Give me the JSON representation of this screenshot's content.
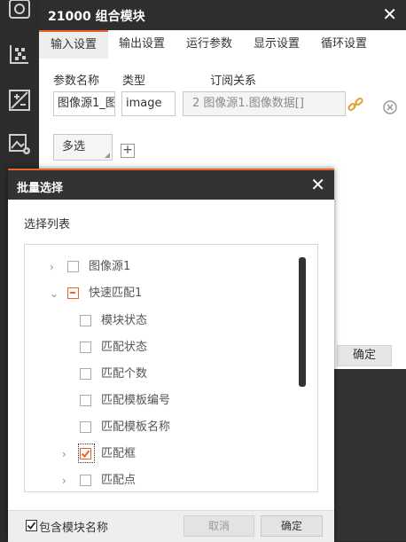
{
  "main_dialog": {
    "title": "21000 组合模块",
    "close": "✕",
    "tabs": [
      "输入设置",
      "输出设置",
      "运行参数",
      "显示设置",
      "循环设置"
    ],
    "active_tab": 0,
    "headers": {
      "param_name": "参数名称",
      "type": "类型",
      "subscription": "订阅关系"
    },
    "row": {
      "name_value": "图像源1_图",
      "type_value": "image",
      "subscription_value": "2 图像源1.图像数据[]"
    },
    "multi_select": "多选",
    "add": "+",
    "confirm_bg": "确定"
  },
  "batch_dialog": {
    "title": "批量选择",
    "close": "✕",
    "list_title": "选择列表",
    "tree": [
      {
        "label": "图像源1",
        "state": "unchecked",
        "arrow": "›"
      },
      {
        "label": "快速匹配1",
        "state": "partial",
        "arrow": "⌄"
      },
      {
        "label": "模块状态",
        "state": "unchecked"
      },
      {
        "label": "匹配状态",
        "state": "unchecked"
      },
      {
        "label": "匹配个数",
        "state": "unchecked"
      },
      {
        "label": "匹配模板编号",
        "state": "unchecked"
      },
      {
        "label": "匹配模板名称",
        "state": "unchecked"
      },
      {
        "label": "匹配框",
        "state": "checked",
        "arrow": "›"
      },
      {
        "label": "匹配点",
        "state": "unchecked",
        "arrow": "›"
      }
    ],
    "include_module_name": "包含模块名称",
    "include_checked": true,
    "cancel": "取消",
    "confirm": "确定"
  },
  "colors": {
    "accent": "#e8642c",
    "dark_bg": "#2b2b2b"
  },
  "icons": [
    "dataset-icon",
    "calibration-icon",
    "image-settings-icon",
    "camera-icon",
    "link-icon",
    "remove-circle-icon"
  ]
}
